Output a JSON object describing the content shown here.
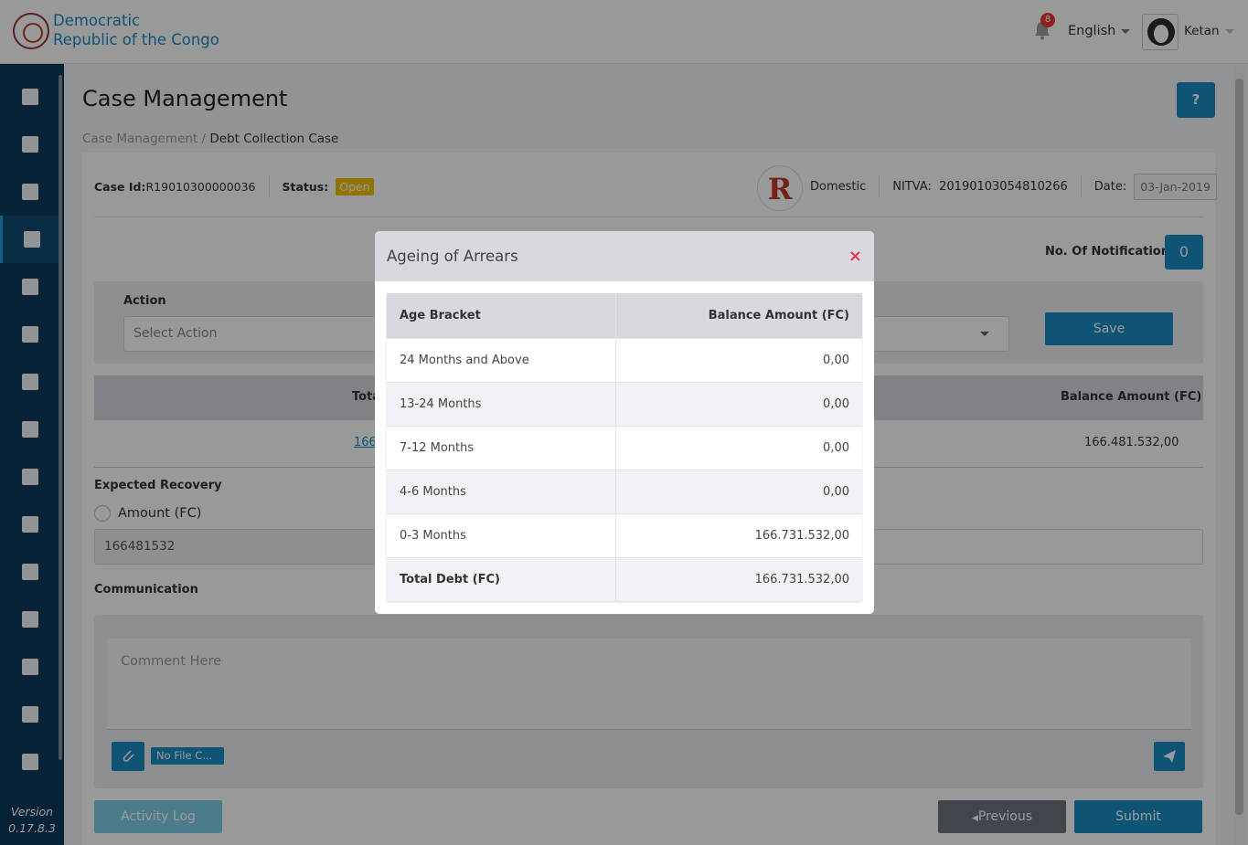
{
  "header": {
    "brand_line1": "Democratic",
    "brand_line2": "Republic of the Congo",
    "notification_count": "8",
    "language": "English",
    "user_name": "Ketan"
  },
  "sidebar": {
    "version_label": "Version",
    "version_number": "0.17.8.3",
    "icons": [
      "dashboard-icon",
      "clipboard-icon",
      "search-document-icon",
      "folder-open-icon",
      "briefcase-icon",
      "user-settings-icon",
      "document-icon",
      "document-list-icon",
      "database-settings-icon",
      "document-search-icon",
      "user-icon",
      "chart-user-icon",
      "user-tie-icon",
      "user-secret-icon",
      "help-icon"
    ],
    "active_index": 3
  },
  "page": {
    "title": "Case Management",
    "help_label": "?",
    "breadcrumb_root": "Case Management",
    "breadcrumb_sep": " / ",
    "breadcrumb_current": "Debt Collection Case"
  },
  "case_info": {
    "case_id_label": "Case Id:",
    "case_id": "R19010300000036",
    "status_label": "Status:",
    "status_value": "Open",
    "taxpayer_type": "Domestic",
    "nitva_label": "NITVA:",
    "nitva_value": "20190103054810266",
    "date_label": "Date:",
    "date_value": "03-Jan-2019",
    "logo_letter": "R"
  },
  "notification": {
    "label": "No. Of Notification:",
    "count": "0"
  },
  "action": {
    "label": "Action",
    "placeholder": "Select Action",
    "save_label": "Save"
  },
  "summary_table": {
    "col_total": "Tota",
    "col_balance": "Balance Amount (FC)",
    "total_link": "166.",
    "balance": "166.481.532,00"
  },
  "expected_recovery": {
    "label": "Expected Recovery",
    "radio_label": "Amount (FC)",
    "amount_value": "166481532"
  },
  "communication": {
    "label": "Communication",
    "comment_placeholder": "Comment Here",
    "file_label": "No File C..."
  },
  "footer_buttons": {
    "activity_log": "Activity Log",
    "previous": "Previous",
    "submit": "Submit"
  },
  "modal": {
    "title": "Ageing of Arrears",
    "close_label": "×",
    "columns": [
      "Age Bracket",
      "Balance Amount (FC)"
    ],
    "rows": [
      {
        "bracket": "24 Months and Above",
        "amount": "0,00"
      },
      {
        "bracket": "13-24 Months",
        "amount": "0,00"
      },
      {
        "bracket": "7-12 Months",
        "amount": "0,00"
      },
      {
        "bracket": "4-6 Months",
        "amount": "0,00"
      },
      {
        "bracket": "0-3 Months",
        "amount": "166.731.532,00"
      }
    ],
    "total_label": "Total Debt (FC)",
    "total_amount": "166.731.532,00"
  },
  "colors": {
    "primary": "#1a8cc4",
    "sidebar": "#0b3a5c",
    "status_open": "#f2c200",
    "close_icon": "#e53950"
  }
}
